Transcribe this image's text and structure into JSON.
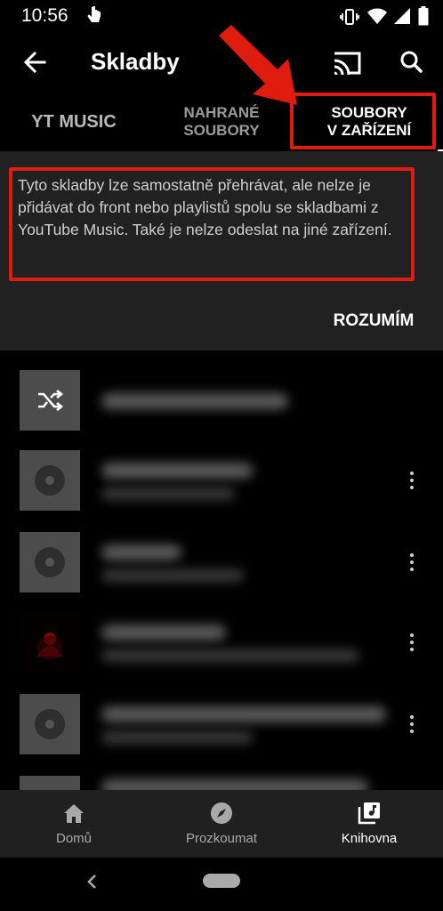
{
  "status_bar": {
    "time": "10:56"
  },
  "toolbar": {
    "title": "Skladby"
  },
  "tabs": [
    {
      "label": "YT MUSIC"
    },
    {
      "label_line1": "NAHRANÉ",
      "label_line2": "SOUBORY"
    },
    {
      "label_line1": "SOUBORY",
      "label_line2": "V ZAŘÍZENÍ",
      "selected": true
    }
  ],
  "banner": {
    "text": "Tyto skladby lze samostatně přehrávat, ale nelze je přidávat do front nebo playlistů spolu se skladbami z YouTube Music. Také je nelze odeslat na jiné zařízení.",
    "button": "ROZUMÍM"
  },
  "list": {
    "shuffle_icon": "shuffle-icon",
    "rows": [
      {
        "thumb": "music-disc-icon"
      },
      {
        "thumb": "music-disc-icon"
      },
      {
        "thumb": "album-art"
      },
      {
        "thumb": "music-disc-icon"
      }
    ]
  },
  "bottom_nav": [
    {
      "label": "Domů",
      "icon": "home-icon"
    },
    {
      "label": "Prozkoumat",
      "icon": "compass-icon"
    },
    {
      "label": "Knihovna",
      "icon": "library-icon",
      "active": true
    }
  ],
  "colors": {
    "highlight_red": "#e01c0f",
    "banner_bg": "#212121",
    "nav_bg": "#202020"
  }
}
